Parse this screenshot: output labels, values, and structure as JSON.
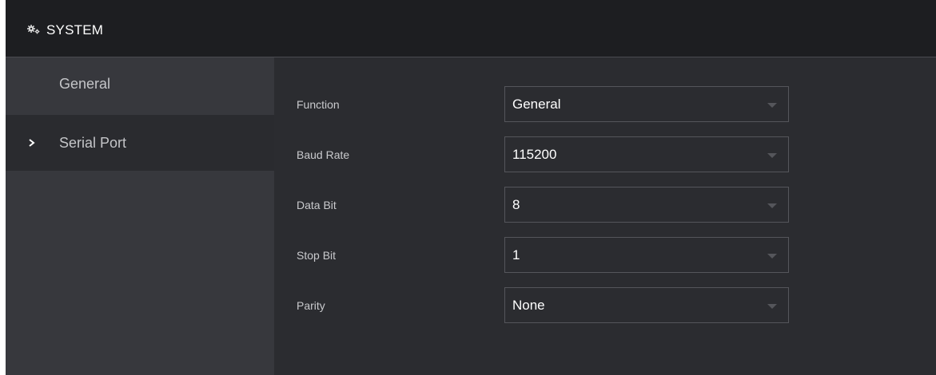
{
  "header": {
    "title": "SYSTEM",
    "icon": "gears-icon"
  },
  "sidebar": {
    "items": [
      {
        "label": "General",
        "selected": false
      },
      {
        "label": "Serial Port",
        "selected": true,
        "indicator": "chevron-right-icon"
      }
    ]
  },
  "form": {
    "fields": [
      {
        "label": "Function",
        "value": "General"
      },
      {
        "label": "Baud Rate",
        "value": "115200"
      },
      {
        "label": "Data Bit",
        "value": "8"
      },
      {
        "label": "Stop Bit",
        "value": "1"
      },
      {
        "label": "Parity",
        "value": "None"
      }
    ]
  },
  "colors": {
    "header_bg": "#1d1e21",
    "sidebar_bg": "#37383d",
    "sidebar_selected_bg": "#2a2b2f",
    "content_bg": "#2b2c30",
    "select_border": "#55565b",
    "text_primary": "#ffffff",
    "text_secondary": "#c9cacd"
  }
}
